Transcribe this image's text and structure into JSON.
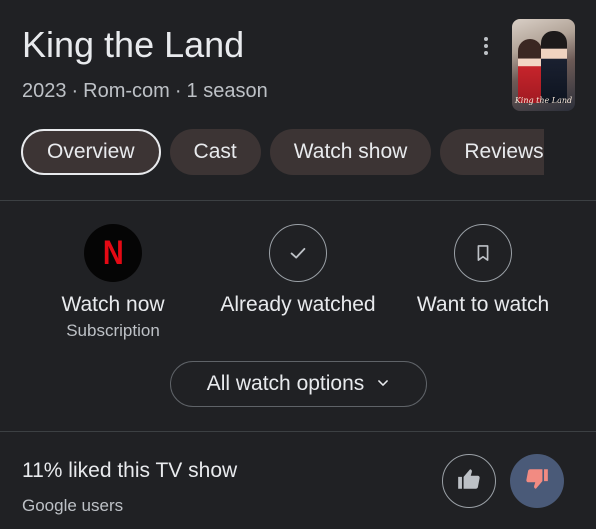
{
  "header": {
    "title": "King the Land",
    "year": "2023",
    "genre": "Rom-com",
    "seasons": "1 season",
    "separator": "·",
    "poster_caption": "King the Land"
  },
  "tabs": [
    {
      "label": "Overview",
      "active": true
    },
    {
      "label": "Cast",
      "active": false
    },
    {
      "label": "Watch show",
      "active": false
    },
    {
      "label": "Reviews",
      "active": false
    }
  ],
  "actions": {
    "watch_now": {
      "label": "Watch now",
      "sublabel": "Subscription",
      "icon": "netflix-logo-icon",
      "glyph": "N"
    },
    "already_watched": {
      "label": "Already watched",
      "icon": "checkmark-icon"
    },
    "want_to_watch": {
      "label": "Want to watch",
      "icon": "bookmark-icon"
    }
  },
  "all_options": {
    "label": "All watch options",
    "icon": "chevron-down-icon"
  },
  "rating": {
    "text": "11% liked this TV show",
    "source": "Google users",
    "thumbs_up_icon": "thumbs-up-icon",
    "thumbs_down_icon": "thumbs-down-icon",
    "thumbs_down_selected": true
  },
  "colors": {
    "background": "#202124",
    "chip": "#3c3434",
    "netflix_red": "#e50914",
    "thumbs_down_bg": "#4a5a78",
    "thumbs_down_fg": "#f28b82"
  }
}
